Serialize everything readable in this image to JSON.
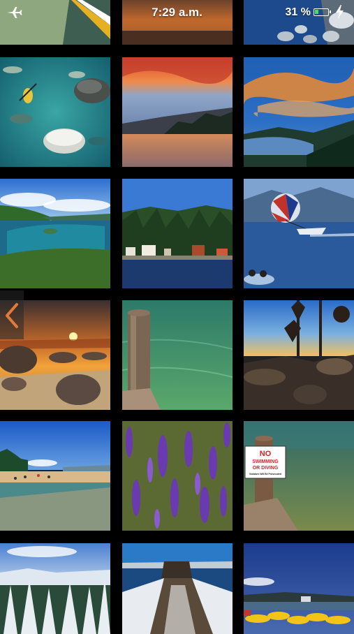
{
  "status_bar": {
    "time": "7:29 a.m.",
    "battery_percent": "31 %",
    "battery_level": 0.31,
    "icons": [
      "airplane-mode-icon",
      "battery-icon",
      "charging-icon"
    ],
    "battery_color": "#4cd964"
  },
  "gallery": {
    "tiles": [
      {
        "name": "photo-kayak-shore"
      },
      {
        "name": "photo-sunset-lake-top"
      },
      {
        "name": "photo-rocky-shore"
      },
      {
        "name": "photo-kayak-clear-water"
      },
      {
        "name": "photo-sunset-lake-shore"
      },
      {
        "name": "photo-dramatic-sky-lake"
      },
      {
        "name": "photo-emerald-bay"
      },
      {
        "name": "photo-lakeside-cabins"
      },
      {
        "name": "photo-parasailing"
      },
      {
        "name": "photo-beach-sunset-boulders"
      },
      {
        "name": "photo-wooden-post-clear-water"
      },
      {
        "name": "photo-pine-silhouettes-sunset"
      },
      {
        "name": "photo-sandy-beach-people"
      },
      {
        "name": "photo-purple-lupines"
      },
      {
        "name": "photo-no-swimming-sign"
      },
      {
        "name": "photo-snowy-pines"
      },
      {
        "name": "photo-snowy-pier"
      },
      {
        "name": "photo-yellow-kayaks"
      }
    ],
    "sign": {
      "line1": "NO",
      "line2": "SWIMMING",
      "line3": "OR DIVING",
      "line4": "Violators Will Be Prosecuted"
    }
  },
  "navigation": {
    "back_icon": "chevron-left-icon"
  }
}
